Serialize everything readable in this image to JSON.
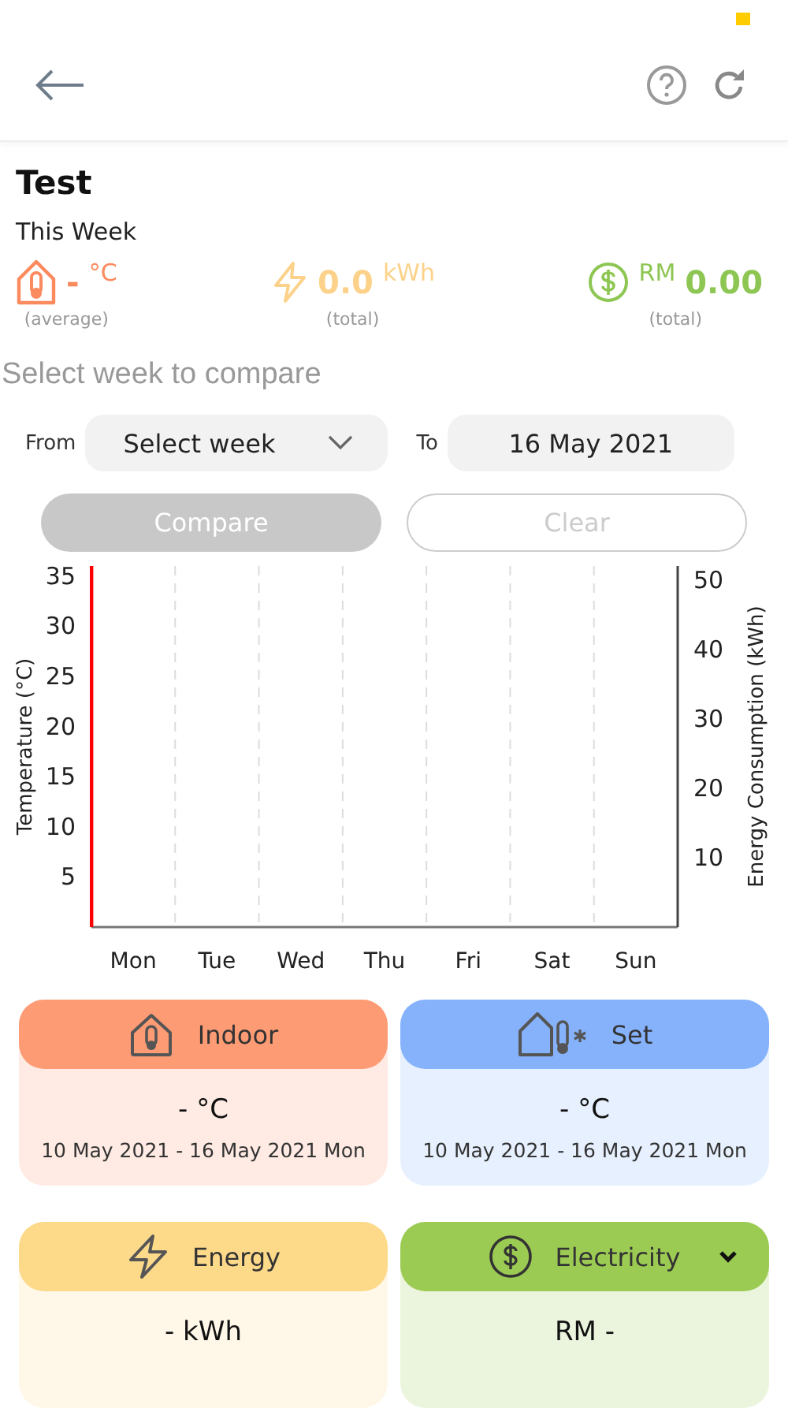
{
  "title": "Test",
  "period": "This Week",
  "stats": [
    {
      "kind": "temperature",
      "value": "-",
      "unit": "°C",
      "note": "(average)"
    },
    {
      "kind": "energy",
      "value": "0.0",
      "unit": "kWh",
      "note": "(total)"
    },
    {
      "kind": "cost",
      "unit": "RM",
      "value": "0.00",
      "note": "(total)"
    }
  ],
  "compare": {
    "heading": "Select week to compare",
    "from_label": "From",
    "from_placeholder": "Select week",
    "to_label": "To",
    "to_value": "16 May 2021",
    "compare_button": {
      "label": "Compare",
      "disabled": true
    },
    "clear_button": {
      "label": "Clear",
      "disabled": true
    }
  },
  "chart": {
    "chart_data": {
      "type": "line",
      "ylabel": "Temperature (°C)",
      "categories": [
        "Mon",
        "Tue",
        "Wed",
        "Thu",
        "Fri",
        "Sat",
        "Sun"
      ],
      "yticks": [
        5,
        10,
        15,
        20,
        25,
        30,
        35
      ],
      "ylim": [
        0,
        36
      ]
    },
    "right_axis": {
      "title": "Energy Consumption (kWh)",
      "ticks": [
        "50",
        "40",
        "30",
        "20",
        "10"
      ]
    }
  },
  "cards": [
    {
      "kind": "indoor",
      "title": "Indoor",
      "color": "#fd9b75",
      "value": "- °C",
      "range": "10 May 2021 - 16 May 2021 Mon"
    },
    {
      "kind": "set",
      "title": "Set",
      "color": "#86b2fc",
      "value": "- °C",
      "range": "10 May 2021 - 16 May 2021 Mon"
    },
    {
      "kind": "energy",
      "title": "Energy",
      "color": "#fdd98a",
      "value": "- kWh"
    },
    {
      "kind": "electricity",
      "title": "Electricity",
      "color": "#9ccb54",
      "value": "RM -",
      "dropdown": true
    }
  ]
}
